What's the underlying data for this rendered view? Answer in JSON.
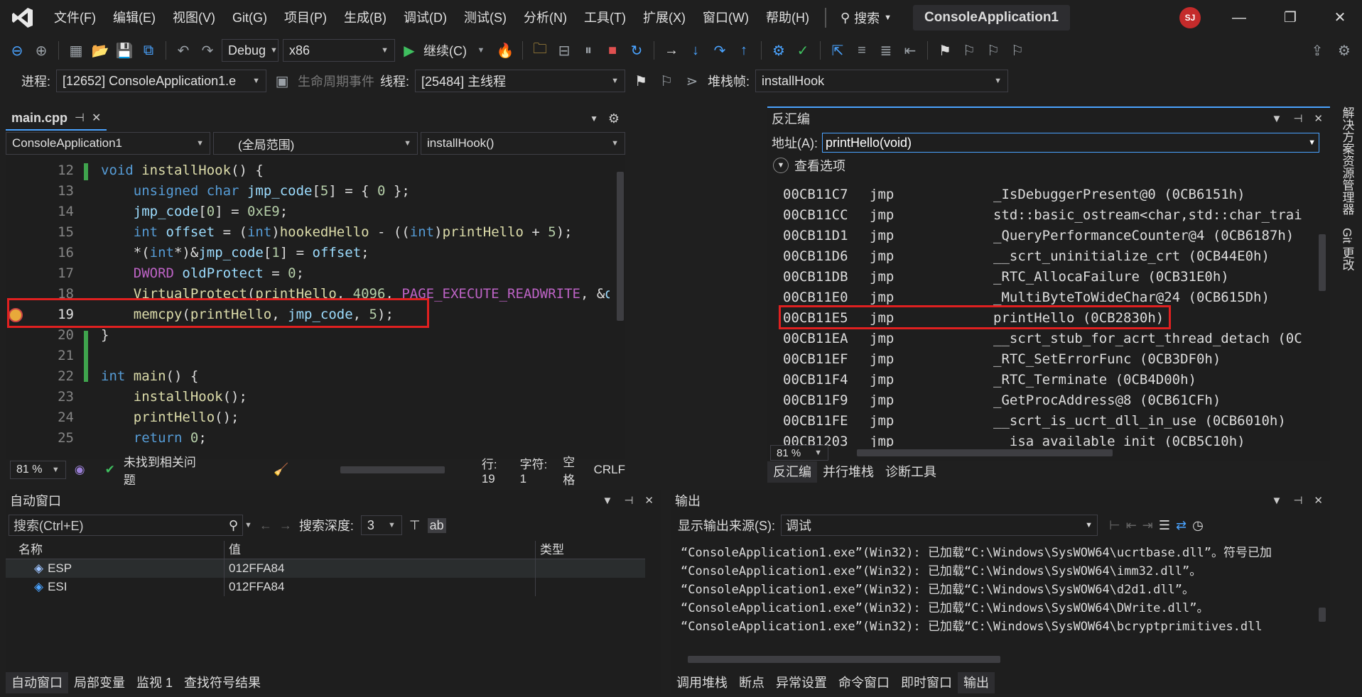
{
  "menu": {
    "items": [
      "文件(F)",
      "编辑(E)",
      "视图(V)",
      "Git(G)",
      "项目(P)",
      "生成(B)",
      "调试(D)",
      "测试(S)",
      "分析(N)",
      "工具(T)",
      "扩展(X)",
      "窗口(W)",
      "帮助(H)"
    ],
    "search_label": "搜索",
    "project_title": "ConsoleApplication1",
    "avatar_initials": "SJ"
  },
  "toolbar": {
    "config": "Debug",
    "platform": "x86",
    "continue_label": "继续(C)",
    "process_label": "进程:",
    "process_value": "[12652] ConsoleApplication1.e",
    "lifecycle_label": "生命周期事件",
    "thread_label": "线程:",
    "thread_value": "[25484] 主线程",
    "stackframe_label": "堆栈帧:",
    "stackframe_value": "installHook"
  },
  "editor": {
    "tab_name": "main.cpp",
    "project_combo": "ConsoleApplication1",
    "scope_combo": "(全局范围)",
    "function_combo": "installHook()",
    "zoom": "81 %",
    "issues": "未找到相关问题",
    "line_pos": "行: 19",
    "char_pos": "字符: 1",
    "indent": "空格",
    "eol": "CRLF",
    "line_numbers": [
      "12",
      "13",
      "14",
      "15",
      "16",
      "17",
      "18",
      "19",
      "20",
      "21",
      "22",
      "23",
      "24",
      "25"
    ]
  },
  "disasm": {
    "title": "反汇编",
    "address_label": "地址(A):",
    "address_value": "printHello(void)",
    "view_options": "查看选项",
    "zoom": "81 %",
    "lines": [
      {
        "addr": "00CB11C7",
        "op": "jmp",
        "target": "_IsDebuggerPresent@0 (0CB6151h)"
      },
      {
        "addr": "00CB11CC",
        "op": "jmp",
        "target": "std::basic_ostream<char,std::char_trai"
      },
      {
        "addr": "00CB11D1",
        "op": "jmp",
        "target": "_QueryPerformanceCounter@4 (0CB6187h)"
      },
      {
        "addr": "00CB11D6",
        "op": "jmp",
        "target": "__scrt_uninitialize_crt (0CB44E0h)"
      },
      {
        "addr": "00CB11DB",
        "op": "jmp",
        "target": "_RTC_AllocaFailure (0CB31E0h)"
      },
      {
        "addr": "00CB11E0",
        "op": "jmp",
        "target": "_MultiByteToWideChar@24 (0CB615Dh)"
      },
      {
        "addr": "00CB11E5",
        "op": "jmp",
        "target": "printHello (0CB2830h)"
      },
      {
        "addr": "00CB11EA",
        "op": "jmp",
        "target": "__scrt_stub_for_acrt_thread_detach (0C"
      },
      {
        "addr": "00CB11EF",
        "op": "jmp",
        "target": "_RTC_SetErrorFunc (0CB3DF0h)"
      },
      {
        "addr": "00CB11F4",
        "op": "jmp",
        "target": "_RTC_Terminate (0CB4D00h)"
      },
      {
        "addr": "00CB11F9",
        "op": "jmp",
        "target": "_GetProcAddress@8 (0CB61CFh)"
      },
      {
        "addr": "00CB11FE",
        "op": "jmp",
        "target": "__scrt_is_ucrt_dll_in_use (0CB6010h)"
      },
      {
        "addr": "00CB1203",
        "op": "jmp",
        "target": "__isa_available_init (0CB5C10h)"
      }
    ],
    "tabs": [
      "反汇编",
      "并行堆栈",
      "诊断工具"
    ]
  },
  "side_tabs": [
    "解决方案资源管理器",
    "Git 更改"
  ],
  "auto": {
    "title": "自动窗口",
    "search_placeholder": "搜索(Ctrl+E)",
    "depth_label": "搜索深度:",
    "depth_value": "3",
    "headers": [
      "名称",
      "值",
      "类型"
    ],
    "rows": [
      {
        "name": "ESP",
        "value": "012FFA84",
        "type": ""
      },
      {
        "name": "ESI",
        "value": "012FFA84",
        "type": ""
      }
    ],
    "tabs": [
      "自动窗口",
      "局部变量",
      "监视 1",
      "查找符号结果"
    ]
  },
  "output": {
    "title": "输出",
    "source_label": "显示输出来源(S):",
    "source_value": "调试",
    "lines": [
      "“ConsoleApplication1.exe”(Win32): 已加载“C:\\Windows\\SysWOW64\\ucrtbase.dll”。符号已加",
      "“ConsoleApplication1.exe”(Win32): 已加载“C:\\Windows\\SysWOW64\\imm32.dll”。",
      "“ConsoleApplication1.exe”(Win32): 已加载“C:\\Windows\\SysWOW64\\d2d1.dll”。",
      "“ConsoleApplication1.exe”(Win32): 已加载“C:\\Windows\\SysWOW64\\DWrite.dll”。",
      "“ConsoleApplication1.exe”(Win32): 已加载“C:\\Windows\\SysWOW64\\bcryptprimitives.dll"
    ],
    "tabs": [
      "调用堆栈",
      "断点",
      "异常设置",
      "命令窗口",
      "即时窗口",
      "输出"
    ]
  }
}
